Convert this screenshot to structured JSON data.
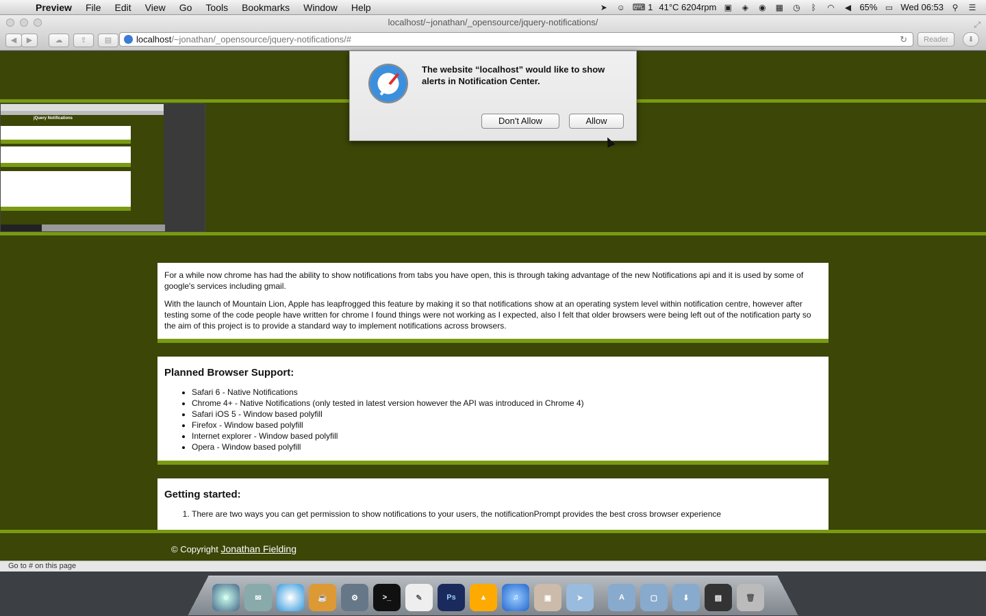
{
  "menubar": {
    "app": "Preview",
    "items": [
      "File",
      "Edit",
      "View",
      "Go",
      "Tools",
      "Bookmarks",
      "Window",
      "Help"
    ],
    "status_keyboard": "1",
    "temp_fan": "41°C 6204rpm",
    "battery": "65%",
    "clock": "Wed 06:53"
  },
  "window": {
    "title": "localhost/~jonathan/_opensource/jquery-notifications/"
  },
  "toolbar": {
    "url_host": "localhost",
    "url_path": "/~jonathan/_opensource/jquery-notifications/#",
    "reader_label": "Reader"
  },
  "dialog": {
    "message": "The website “localhost” would like to show alerts in Notification Center.",
    "deny_label": "Don't Allow",
    "allow_label": "Allow"
  },
  "thumbnail": {
    "title": "jQuery Notifications"
  },
  "intro": {
    "p1": "For a while now chrome has had the ability to show notifications from tabs you have open, this is through taking advantage of the new Notifications api and it is used by some of google's services including gmail.",
    "p2": "With the launch of Mountain Lion, Apple has leapfrogged this feature by making it so that notifications show at an operating system level within notification centre, however after testing some of the code people have written for chrome I found things were not working as I expected, also I felt that older browsers were being left out of the notification party so the aim of this project is to provide a standard way to implement notifications across browsers."
  },
  "support": {
    "heading": "Planned Browser Support:",
    "items": [
      "Safari 6 - Native Notifications",
      "Chrome 4+ - Native Notifications (only tested in latest version however the API was introduced in Chrome 4)",
      "Safari iOS 5 - Window based polyfill",
      "Firefox - Window based polyfill",
      "Internet explorer - Window based polyfill",
      "Opera - Window based polyfill"
    ]
  },
  "getting_started": {
    "heading": "Getting started:",
    "step1": "There are two ways you can get permission to show notifications to your users, the notificationPrompt provides the best cross browser experience"
  },
  "footer": {
    "copyright": "© Copyright",
    "author": "Jonathan Fielding"
  },
  "statusbar": {
    "text": "Go to # on this page"
  }
}
